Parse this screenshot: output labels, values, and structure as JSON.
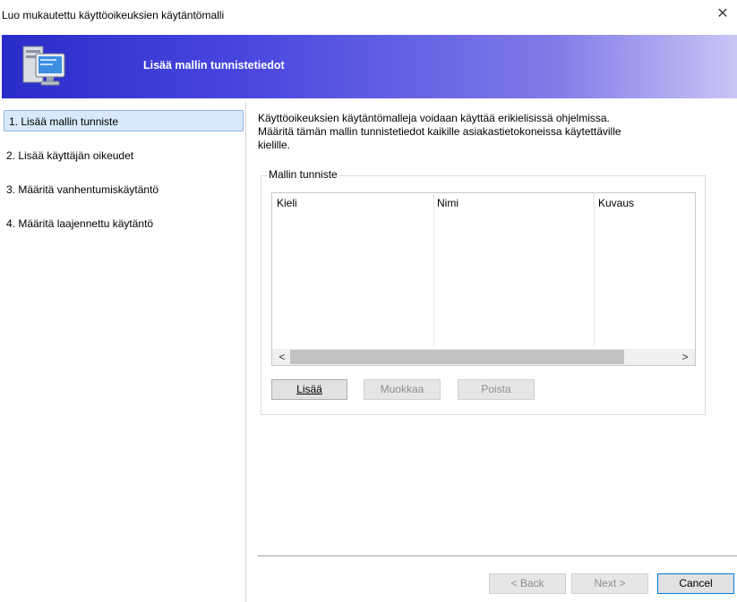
{
  "window": {
    "title": "Luo mukautettu käyttöoikeuksien käytäntömalli",
    "close_glyph": "✕"
  },
  "banner": {
    "title": "Lisää mallin tunnistetiedot",
    "icon": "computer-wizard-icon"
  },
  "steps": [
    {
      "label": "1. Lisää mallin tunniste",
      "active": true
    },
    {
      "label": "2. Lisää käyttäjän oikeudet",
      "active": false
    },
    {
      "label": "3. Määritä vanhentumiskäytäntö",
      "active": false
    },
    {
      "label": "4. Määritä laajennettu käytäntö",
      "active": false
    }
  ],
  "description": {
    "line1": "Käyttöoikeuksien käytäntömalleja voidaan käyttää erikielisissä ohjelmissa.",
    "line2": "Määritä tämän mallin tunnistetiedot kaikille asiakastietokoneissa käytettäville",
    "line3": "kielille."
  },
  "identifier_group": {
    "legend": "Mallin tunniste",
    "columns": [
      "Kieli",
      "Nimi",
      "Kuvaus"
    ],
    "scroll_left": "<",
    "scroll_right": ">",
    "buttons": {
      "add": "Lisää",
      "edit": "Muokkaa",
      "remove": "Poista"
    }
  },
  "footer": {
    "back": "< Back",
    "next": "Next >",
    "cancel": "Cancel"
  },
  "colors": {
    "banner_start": "#2a2cc9",
    "banner_end": "#c9c5f5",
    "active_step": "#d7e9fb"
  }
}
